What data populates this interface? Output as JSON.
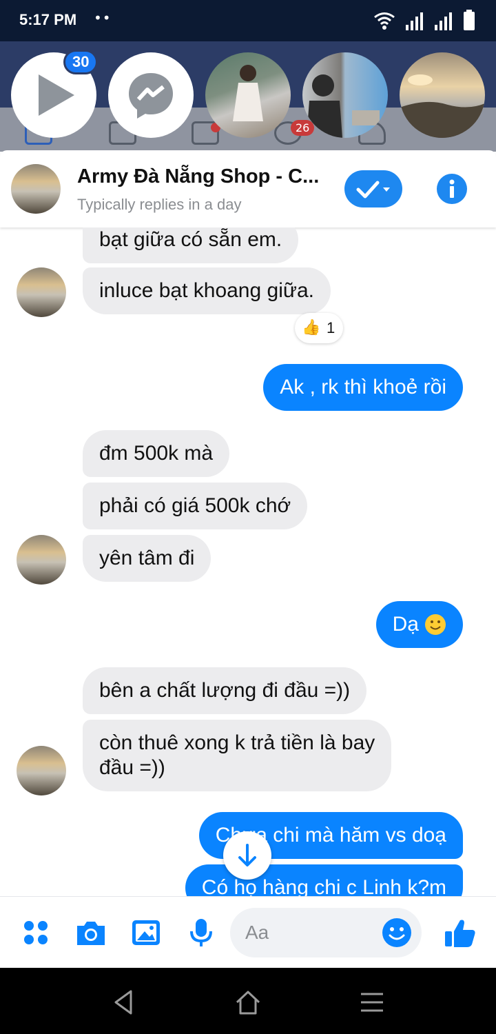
{
  "status_bar": {
    "time": "5:17 PM",
    "dots": "••"
  },
  "chat_heads": {
    "video_badge": "30"
  },
  "background_tabs": {
    "badge_1": "",
    "badge_2": "26"
  },
  "header": {
    "title": "Army Đà Nẵng Shop - C...",
    "subtitle": "Typically replies in a day"
  },
  "messages": [
    {
      "from": "them",
      "text": "bạt giữa có sẵn em."
    },
    {
      "from": "them",
      "text": "inluce bạt khoang giữa."
    },
    {
      "from": "me",
      "text": "Ak , rk thì khoẻ rồi"
    },
    {
      "from": "them",
      "text": "đm 500k mà"
    },
    {
      "from": "them",
      "text": "phải có giá 500k chớ"
    },
    {
      "from": "them",
      "text": "yên tâm đi"
    },
    {
      "from": "me",
      "text": "Dạ"
    },
    {
      "from": "them",
      "text": "bên a chất lượng đi đầu =))"
    },
    {
      "from": "them",
      "text": "còn thuê xong k trả tiền là bay",
      "text2": "đầu =))"
    },
    {
      "from": "me",
      "text": "Chưa chi mà hăm vs doạ"
    },
    {
      "from": "me",
      "text": "Có họ hàng chi c Linh k?m"
    }
  ],
  "reaction": {
    "emoji": "👍",
    "count": "1"
  },
  "composer": {
    "placeholder": "Aa"
  },
  "colors": {
    "accent": "#0a84ff",
    "incoming": "#ececee",
    "status_bar": "#0c1a33"
  }
}
